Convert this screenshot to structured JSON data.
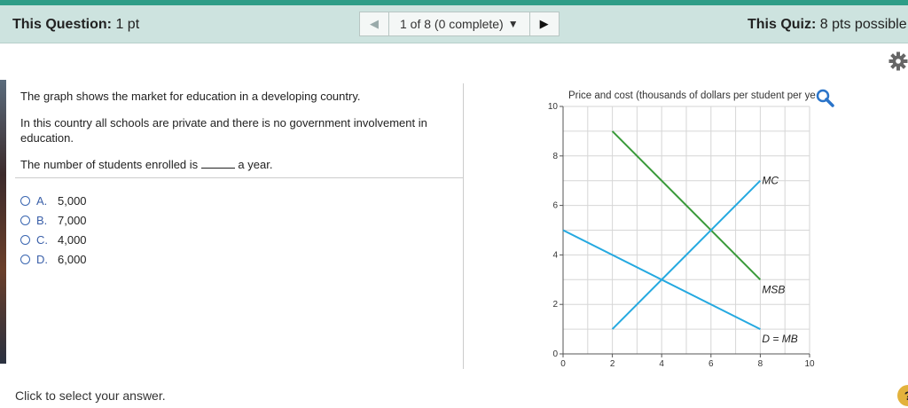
{
  "header": {
    "question_label": "This Question:",
    "question_points": "1 pt",
    "pager_text": "1 of 8 (0 complete)",
    "quiz_label": "This Quiz:",
    "quiz_points": "8 pts possible"
  },
  "question": {
    "line1": "The graph shows the market for education in a developing country.",
    "line2": "In this country all schools are private and there is no government involvement in education.",
    "line3_before": "The number of students enrolled is",
    "line3_after": "a year."
  },
  "options": [
    {
      "letter": "A.",
      "text": "5,000"
    },
    {
      "letter": "B.",
      "text": "7,000"
    },
    {
      "letter": "C.",
      "text": "4,000"
    },
    {
      "letter": "D.",
      "text": "6,000"
    }
  ],
  "footer": {
    "text": "Click to select your answer."
  },
  "icons": {
    "gear": "gear-icon",
    "zoom": "zoom-icon",
    "help": "help-icon"
  },
  "chart_data": {
    "type": "line",
    "ylabel": "Price and cost (thousands of dollars per student per ye",
    "xlim": [
      0,
      10
    ],
    "ylim": [
      0,
      10
    ],
    "x_ticks": [
      "0",
      "2",
      "4",
      "6",
      "8",
      "10"
    ],
    "y_ticks": [
      "0",
      "2",
      "4",
      "6",
      "8",
      "10"
    ],
    "grid": true,
    "series": [
      {
        "name": "MSB",
        "color": "#3a9a3a",
        "x": [
          2,
          8
        ],
        "y": [
          9,
          3
        ]
      },
      {
        "name": "MC",
        "color": "#25a9e0",
        "x": [
          2,
          8
        ],
        "y": [
          1,
          7
        ]
      },
      {
        "name": "D = MB",
        "color": "#25a9e0",
        "x": [
          0,
          8
        ],
        "y": [
          5,
          1
        ]
      }
    ]
  }
}
